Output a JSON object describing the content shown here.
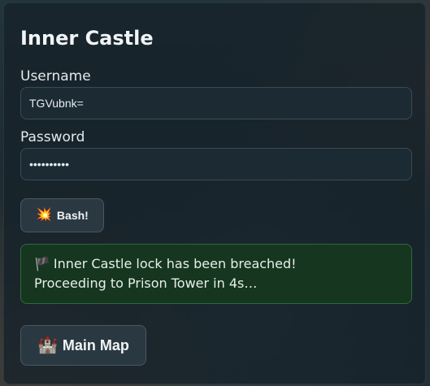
{
  "panel": {
    "title": "Inner Castle"
  },
  "form": {
    "username_label": "Username",
    "username_value": "TGVubnk=",
    "password_label": "Password",
    "password_value": "••••••••••"
  },
  "actions": {
    "bash_icon": "explosion-icon",
    "bash_glyph": "💥",
    "bash_label": "Bash!"
  },
  "alert": {
    "flag_icon": "flag-icon",
    "flag_glyph": "🏴",
    "line1": "Inner Castle lock has been breached!",
    "line2": "Proceeding to Prison Tower in 4s…"
  },
  "nav": {
    "map_icon": "castle-icon",
    "map_glyph": "🏰",
    "map_label": "Main Map"
  },
  "colors": {
    "panel_bg": "#16222a",
    "alert_bg": "#16361f",
    "alert_border": "#2f6a3c",
    "button_bg": "#2a3841"
  }
}
